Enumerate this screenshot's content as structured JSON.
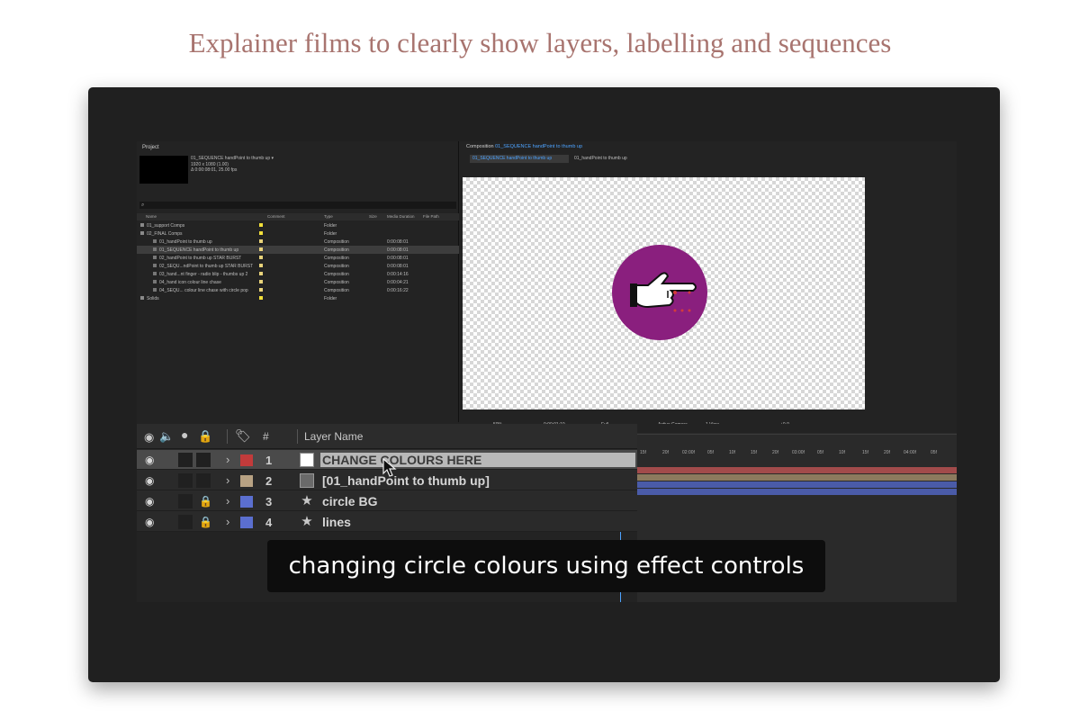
{
  "headline": "Explainer films to clearly show layers, labelling and sequences",
  "project": {
    "title": "Project",
    "comp_name": "01_SEQUENCE handPoint to thumb up ▾",
    "comp_size": "1920 x 1080 (1.00)",
    "comp_duration": "Δ 0:00:08:01, 25.00 fps",
    "search_placeholder": "⌕",
    "columns": {
      "name": "Name",
      "comment": "Comment",
      "type": "Type",
      "size": "Size",
      "duration": "Media Duration",
      "path": "File Path"
    },
    "rows": [
      {
        "name": "01_support Comps",
        "type": "Folder",
        "duration": ""
      },
      {
        "name": "02_FINAL Comps",
        "type": "Folder",
        "duration": ""
      },
      {
        "name": "01_handPoint to thumb up",
        "type": "Composition",
        "duration": "0:00:08:01"
      },
      {
        "name": "01_SEQUENCE handPoint to thumb up",
        "type": "Composition",
        "duration": "0:00:08:01"
      },
      {
        "name": "02_handPoint to thumb up STAR BURST",
        "type": "Composition",
        "duration": "0:00:08:01"
      },
      {
        "name": "02_SEQU...ndPoint to thumb up STAR BURST",
        "type": "Composition",
        "duration": "0:00:08:01"
      },
      {
        "name": "03_hand...nt finger - radio blip - thumbs up 2",
        "type": "Composition",
        "duration": "0:00:14:16"
      },
      {
        "name": "04_hand icon colour line chase",
        "type": "Composition",
        "duration": "0:00:04:21"
      },
      {
        "name": "04_SEQU... colour line chase with circle pop",
        "type": "Composition",
        "duration": "0:00:16:22"
      },
      {
        "name": "Solids",
        "type": "Folder",
        "duration": ""
      }
    ]
  },
  "composition": {
    "title_prefix": "Composition",
    "title_name": "01_SEQUENCE handPoint to thumb up",
    "tab_active": "01_SEQUENCE handPoint to thumb up",
    "tab_other": "01_handPoint to thumb up",
    "zoom": "50%",
    "timecode": "0:00:01:10",
    "resolution": "Full",
    "camera": "Active Camera",
    "views": "1 View",
    "exposure": "+0.0",
    "circle_color": "#8a1f7e"
  },
  "timeline": {
    "header": {
      "hash": "#",
      "layer_name": "Layer Name"
    },
    "ruler_ticks": [
      "15f",
      "20f",
      "02:00f",
      "05f",
      "10f",
      "15f",
      "20f",
      "03:00f",
      "05f",
      "10f",
      "15f",
      "20f",
      "04:00f",
      "05f"
    ],
    "layers": [
      {
        "num": "1",
        "name": "CHANGE COLOURS HERE",
        "label_color": "#c23b3b",
        "locked": false
      },
      {
        "num": "2",
        "name": "[01_handPoint to thumb up]",
        "label_color": "#b8a283",
        "locked": false
      },
      {
        "num": "3",
        "name": "circle BG",
        "label_color": "#5b6fcf",
        "locked": true
      },
      {
        "num": "4",
        "name": "lines",
        "label_color": "#5b6fcf",
        "locked": true
      }
    ]
  },
  "caption": "changing circle colours using effect controls"
}
